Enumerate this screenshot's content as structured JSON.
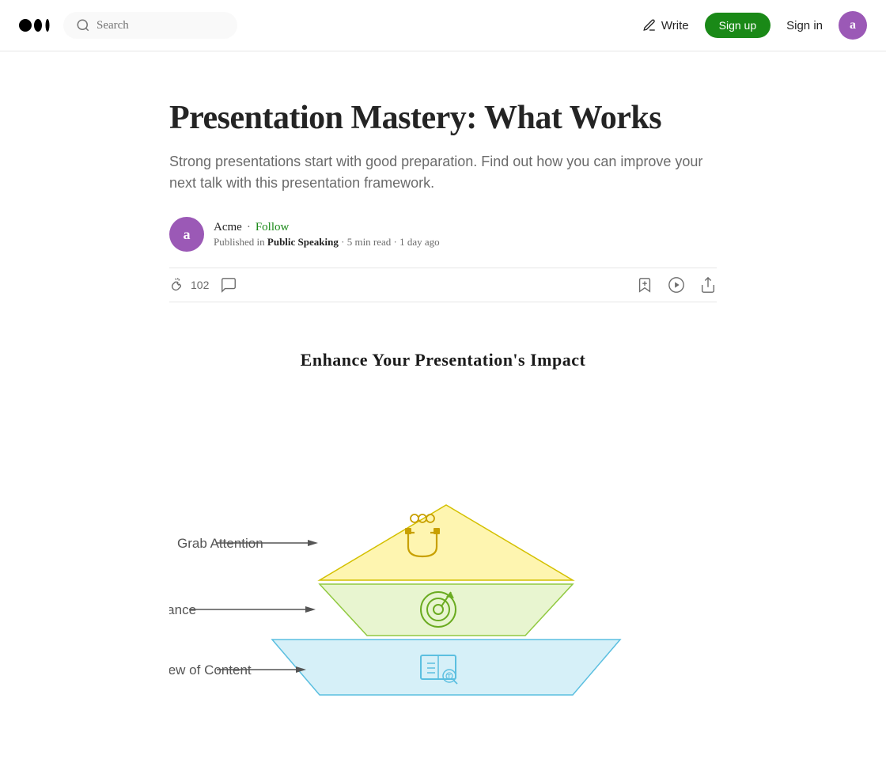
{
  "header": {
    "logo_text": "Medium",
    "search_placeholder": "Search",
    "write_label": "Write",
    "signup_label": "Sign up",
    "signin_label": "Sign in",
    "avatar_letter": "a"
  },
  "article": {
    "title": "Presentation Mastery: What Works",
    "subtitle": "Strong presentations start with good preparation. Find out how you can improve your next talk with this presentation framework.",
    "author": {
      "name": "Acme",
      "follow_label": "Follow",
      "avatar_letter": "a",
      "publication": "Public Speaking",
      "read_time": "5 min read",
      "published": "1 day ago"
    },
    "clap_count": "102",
    "actions": {
      "clap_label": "102",
      "save_label": "Save",
      "listen_label": "Listen",
      "share_label": "Share"
    }
  },
  "diagram": {
    "title": "Enhance Your Presentation's Impact",
    "levels": [
      {
        "label": "Grab Attention",
        "icon": "magnet"
      },
      {
        "label": "Establish Relevance",
        "icon": "target"
      },
      {
        "label": "Preview of Content",
        "icon": "book"
      }
    ]
  }
}
